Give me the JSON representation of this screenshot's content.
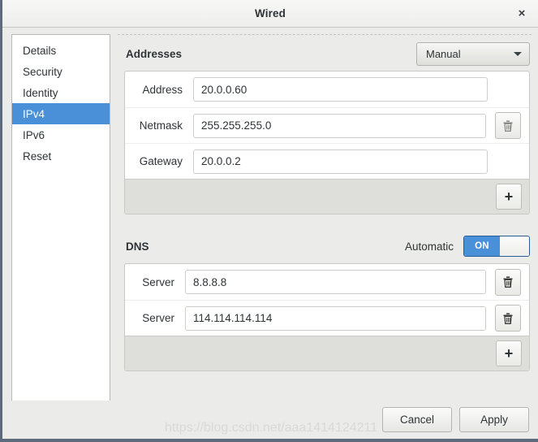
{
  "window": {
    "title": "Wired",
    "close_label": "×"
  },
  "sidebar": {
    "items": [
      {
        "label": "Details",
        "active": false
      },
      {
        "label": "Security",
        "active": false
      },
      {
        "label": "Identity",
        "active": false
      },
      {
        "label": "IPv4",
        "active": true
      },
      {
        "label": "IPv6",
        "active": false
      },
      {
        "label": "Reset",
        "active": false
      }
    ]
  },
  "addresses": {
    "title": "Addresses",
    "method": "Manual",
    "rows": [
      {
        "label": "Address",
        "value": "20.0.0.60"
      },
      {
        "label": "Netmask",
        "value": "255.255.255.0"
      },
      {
        "label": "Gateway",
        "value": "20.0.0.2"
      }
    ],
    "add_label": "+"
  },
  "dns": {
    "title": "DNS",
    "automatic_label": "Automatic",
    "toggle_state": "ON",
    "servers": [
      {
        "label": "Server",
        "value": "8.8.8.8"
      },
      {
        "label": "Server",
        "value": "114.114.114.114"
      }
    ],
    "add_label": "+"
  },
  "footer": {
    "cancel_label": "Cancel",
    "apply_label": "Apply"
  },
  "watermark": {
    "text": "https://blog.csdn.net/aaa1414124211"
  },
  "colors": {
    "accent": "#4a90d9",
    "window_bg": "#ebebe9",
    "border": "#5d6b7d"
  }
}
